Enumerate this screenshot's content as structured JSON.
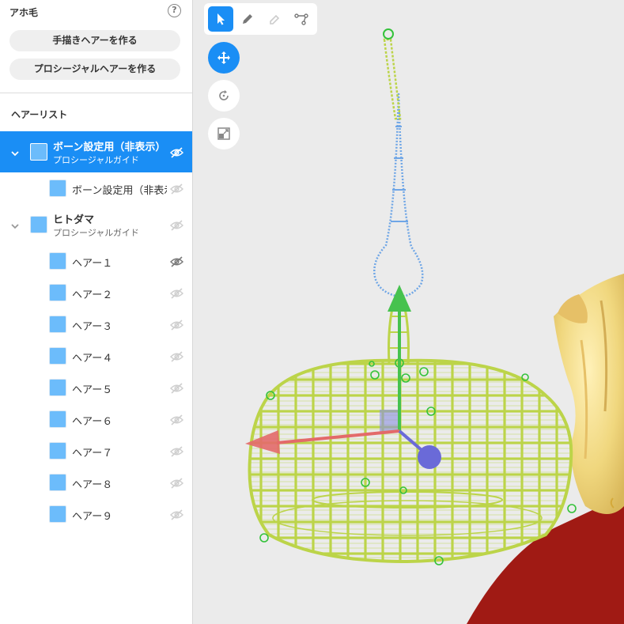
{
  "panel": {
    "section_title": "アホ毛",
    "help_icon": "?",
    "buttons": {
      "hand_drawn": "手描きヘアーを作る",
      "procedural": "プロシージャルヘアーを作る"
    },
    "list_title": "ヘアーリスト"
  },
  "groups": [
    {
      "name": "ボーン設定用（非表示）",
      "subtitle": "プロシージャルガイド",
      "selected": true,
      "expanded": true,
      "visible": false,
      "children": [
        {
          "name": "ボーン設定用（非表示）",
          "visible": false
        }
      ]
    },
    {
      "name": "ヒトダマ",
      "subtitle": "プロシージャルガイド",
      "selected": false,
      "expanded": true,
      "visible": false,
      "children": [
        {
          "name": "ヘアー１",
          "visible": false
        },
        {
          "name": "ヘアー２",
          "visible": false
        },
        {
          "name": "ヘアー３",
          "visible": false
        },
        {
          "name": "ヘアー４",
          "visible": false
        },
        {
          "name": "ヘアー５",
          "visible": false
        },
        {
          "name": "ヘアー６",
          "visible": false
        },
        {
          "name": "ヘアー７",
          "visible": false
        },
        {
          "name": "ヘアー８",
          "visible": false
        },
        {
          "name": "ヘアー９",
          "visible": false
        }
      ]
    }
  ],
  "tools": {
    "top": [
      "select-tool",
      "pen-tool",
      "eraser-tool",
      "path-edit-tool"
    ],
    "active_top": "select-tool",
    "transform": [
      "move-tool",
      "rotate-tool",
      "scale-tool"
    ],
    "active_transform": "move-tool"
  },
  "colors": {
    "accent": "#1a8ef5",
    "swatch": "#6cbcfb",
    "wire_green": "#bcd449",
    "spike_blue": "#6fa6e6",
    "gizmo_x": "#e36a6a",
    "gizmo_y": "#46c24e",
    "gizmo_z": "#6a6ad8",
    "hair": "#f0d77e",
    "clothing": "#a01a14"
  }
}
